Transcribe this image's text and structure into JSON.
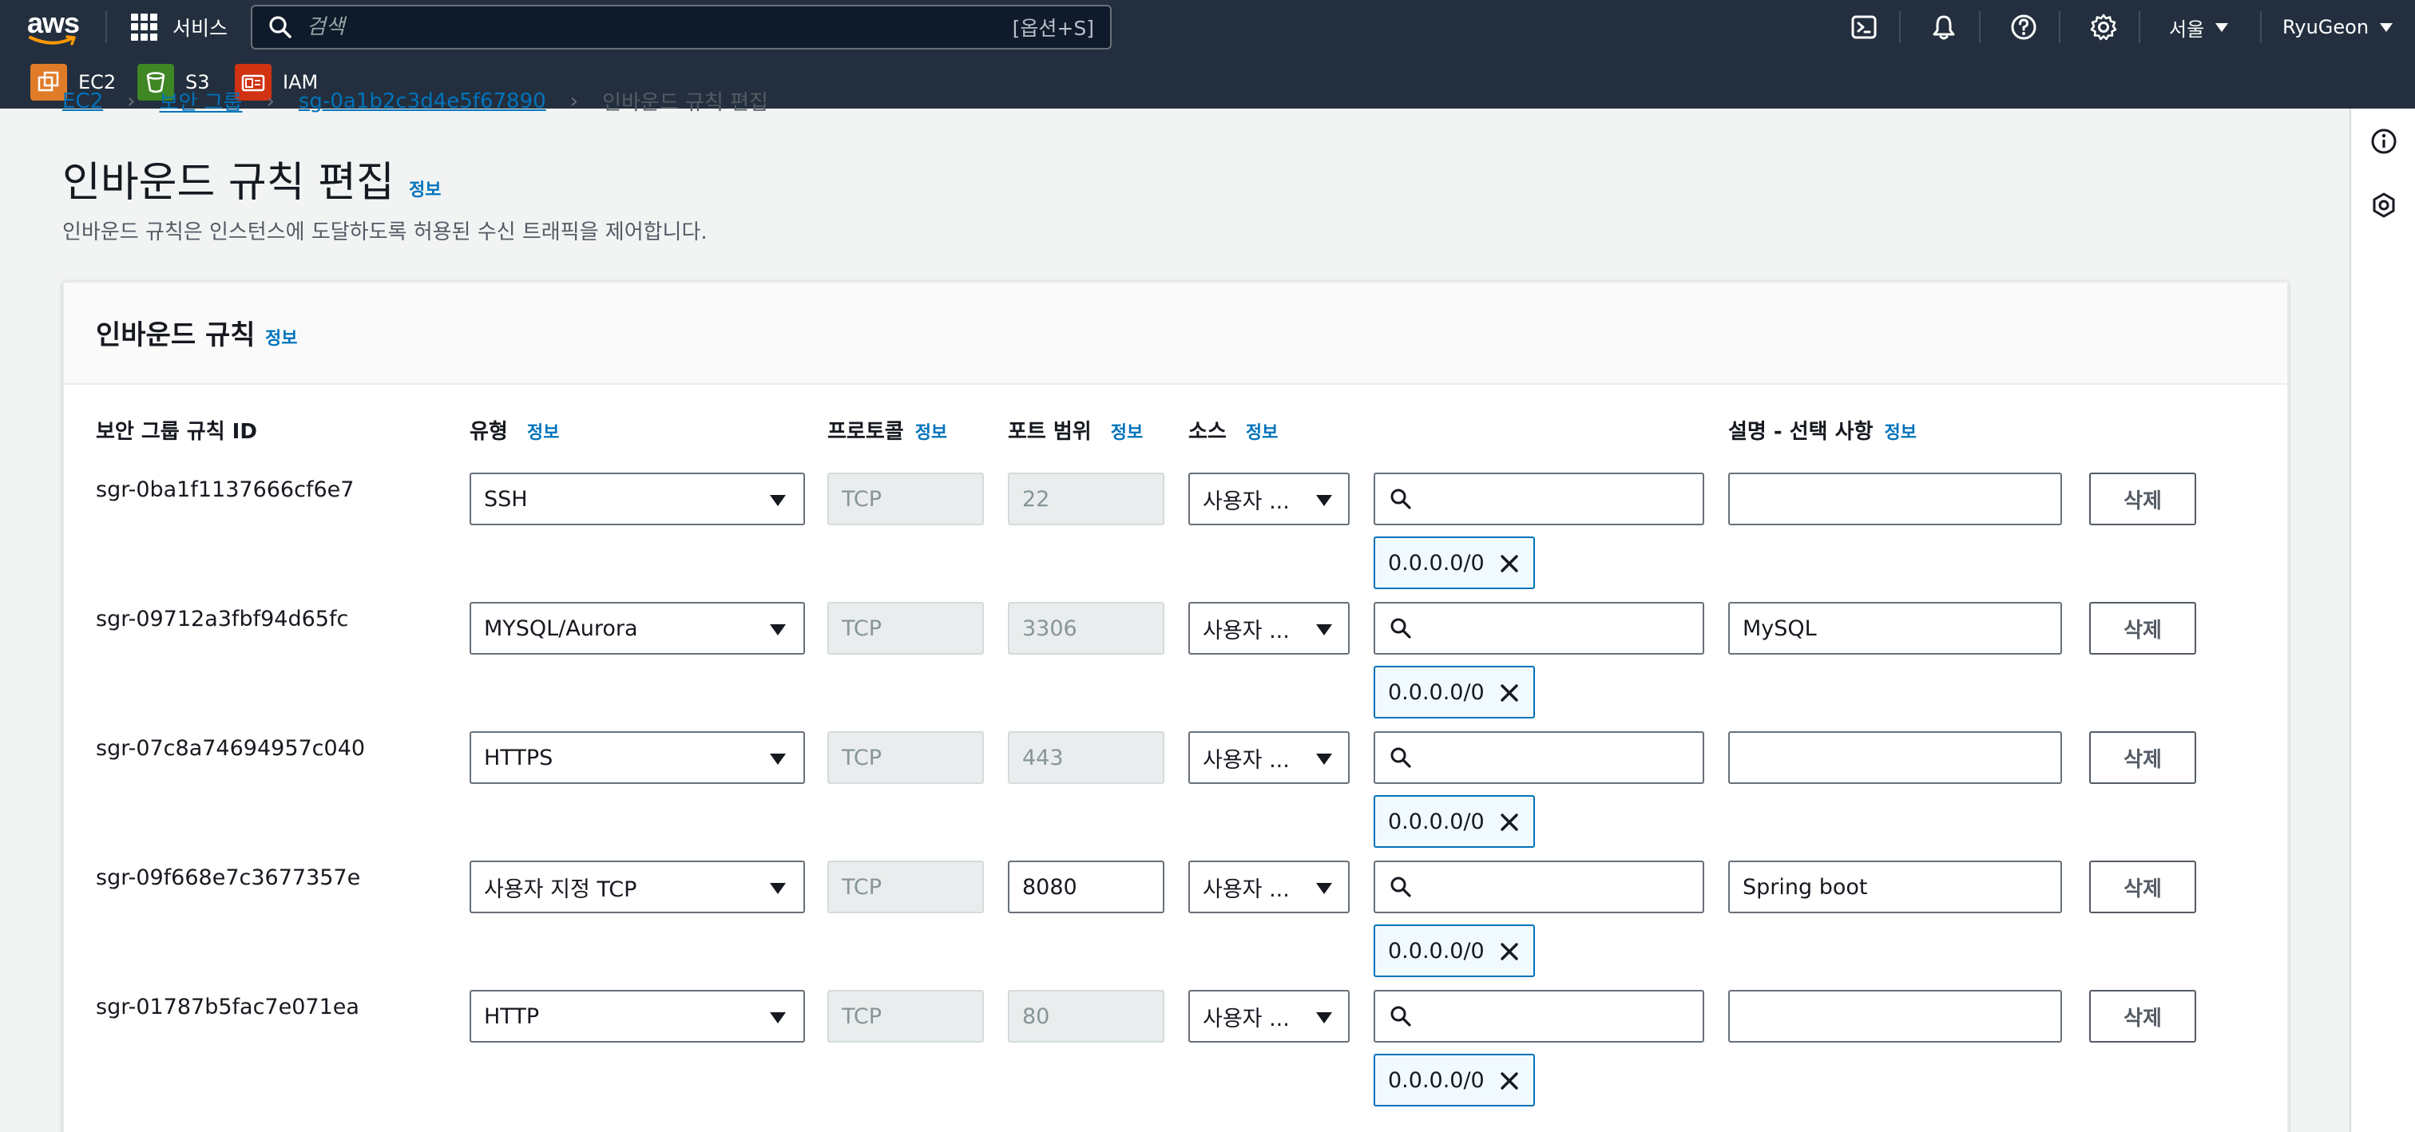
{
  "topnav": {
    "logo_text": "aws",
    "services_label": "서비스",
    "search_placeholder": "검색",
    "search_shortcut": "[옵션+S]",
    "region": "서울",
    "user": "RyuGeon"
  },
  "favorites": [
    {
      "label": "EC2",
      "color": "#e07b28"
    },
    {
      "label": "S3",
      "color": "#3f8624"
    },
    {
      "label": "IAM",
      "color": "#d13212"
    }
  ],
  "breadcrumb": [
    {
      "label": "EC2"
    },
    {
      "label": "보안 그룹"
    },
    {
      "label": "sg-0a1b2c3d4e5f67890"
    },
    {
      "label": "인바운드 규칙 편집"
    }
  ],
  "page": {
    "title": "인바운드 규칙 편집",
    "info": "정보",
    "description": "인바운드 규칙은 인스턴스에 도달하도록 허용된 수신 트래픽을 제어합니다."
  },
  "panel": {
    "title": "인바운드 규칙",
    "info": "정보",
    "columns": {
      "rule_id": "보안 그룹 규칙 ID",
      "type": "유형",
      "protocol": "프로토콜",
      "port_range": "포트 범위",
      "source": "소스",
      "description": "설명 - 선택 사항",
      "info": "정보"
    }
  },
  "rules": [
    {
      "id": "sgr-0ba1f1137666cf6e7",
      "type": "SSH",
      "protocol": "TCP",
      "port": "22",
      "port_editable": false,
      "source": "사용자 ...",
      "cidr": "0.0.0.0/0",
      "description": "",
      "delete": "삭제"
    },
    {
      "id": "sgr-09712a3fbf94d65fc",
      "type": "MYSQL/Aurora",
      "protocol": "TCP",
      "port": "3306",
      "port_editable": false,
      "source": "사용자 ...",
      "cidr": "0.0.0.0/0",
      "description": "MySQL",
      "delete": "삭제"
    },
    {
      "id": "sgr-07c8a74694957c040",
      "type": "HTTPS",
      "protocol": "TCP",
      "port": "443",
      "port_editable": false,
      "source": "사용자 ...",
      "cidr": "0.0.0.0/0",
      "description": "",
      "delete": "삭제"
    },
    {
      "id": "sgr-09f668e7c3677357e",
      "type": "사용자 지정 TCP",
      "protocol": "TCP",
      "port": "8080",
      "port_editable": true,
      "source": "사용자 ...",
      "cidr": "0.0.0.0/0",
      "description": "Spring boot",
      "delete": "삭제"
    },
    {
      "id": "sgr-01787b5fac7e071ea",
      "type": "HTTP",
      "protocol": "TCP",
      "port": "80",
      "port_editable": false,
      "source": "사용자 ...",
      "cidr": "0.0.0.0/0",
      "description": "",
      "delete": "삭제"
    }
  ],
  "colors": {
    "nav_bg": "#232f3e",
    "link": "#0073bb",
    "token_border": "#0073bb"
  }
}
